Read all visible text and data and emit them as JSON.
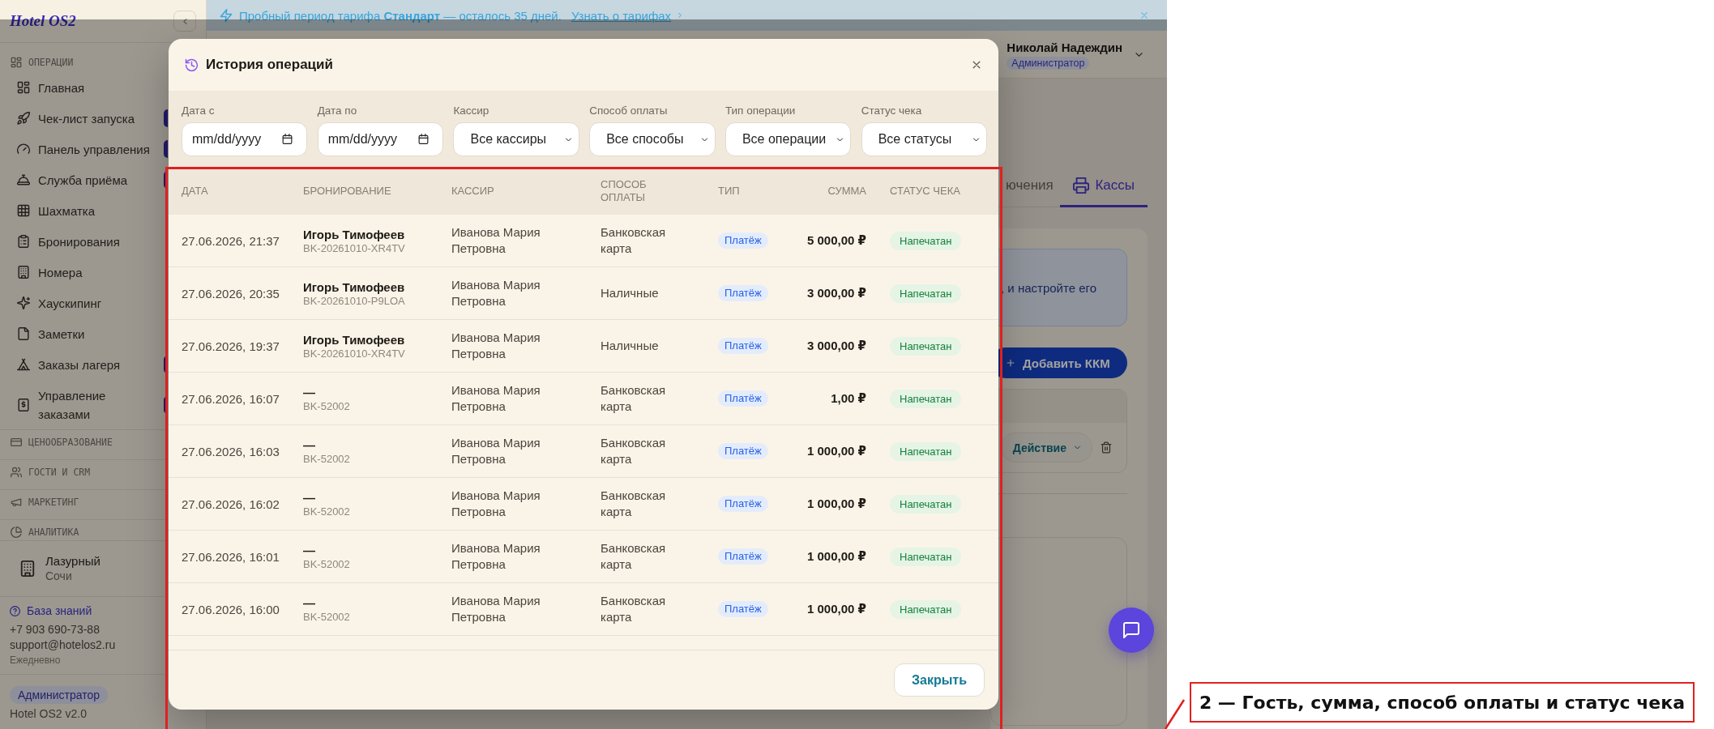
{
  "sidebar": {
    "logo": "Hotel OS2",
    "sections": [
      {
        "title": "ОПЕРАЦИИ",
        "items": [
          {
            "label": "Главная",
            "badge": false
          },
          {
            "label": "Чек-лист запуска",
            "badge": true
          },
          {
            "label": "Панель управления",
            "badge": true
          },
          {
            "label": "Служба приёма",
            "badge": true
          },
          {
            "label": "Шахматка",
            "badge": false
          },
          {
            "label": "Бронирования",
            "badge": false
          },
          {
            "label": "Номера",
            "badge": false
          },
          {
            "label": "Хаускипинг",
            "badge": false
          },
          {
            "label": "Заметки",
            "badge": false
          },
          {
            "label": "Заказы лагеря",
            "badge": true
          },
          {
            "label": "Управление заказами",
            "badge": true
          }
        ]
      },
      {
        "title": "ЦЕНООБРАЗОВАНИЕ"
      },
      {
        "title": "ГОСТИ И CRM"
      },
      {
        "title": "МАРКЕТИНГ"
      },
      {
        "title": "АНАЛИТИКА"
      }
    ],
    "property": {
      "name": "Лазурный",
      "city": "Сочи"
    },
    "support": {
      "knowledge_base": "База знаний",
      "phone": "+7 903 690-73-88",
      "email": "support@hotelos2.ru",
      "hours": "Ежедневно"
    },
    "role": "Администратор",
    "version": "Hotel OS2 v2.0"
  },
  "banner": {
    "text": "Пробный период тарифа **Стандарт** — осталось 35 дней.",
    "link": "Узнать о тарифах"
  },
  "header": {
    "user_name": "Николай Надеждин",
    "user_role": "Администратор"
  },
  "page": {
    "tabs": [
      {
        "label": "ючения",
        "selected": false
      },
      {
        "label": "Кассы",
        "selected": true
      }
    ],
    "info_text": ", и настройте его",
    "add_button": "Добавить ККМ",
    "action_button": "Действие"
  },
  "modal": {
    "title": "История операций",
    "filters": [
      {
        "kind": "date",
        "label": "Дата с",
        "placeholder": "mm/dd/yyyy"
      },
      {
        "kind": "date",
        "label": "Дата по",
        "placeholder": "mm/dd/yyyy"
      },
      {
        "kind": "select",
        "label": "Кассир",
        "value": "Все кассиры"
      },
      {
        "kind": "select",
        "label": "Способ оплаты",
        "value": "Все способы"
      },
      {
        "kind": "select",
        "label": "Тип операции",
        "value": "Все операции"
      },
      {
        "kind": "select",
        "label": "Статус чека",
        "value": "Все статусы"
      }
    ],
    "table": {
      "columns": [
        "ДАТА",
        "БРОНИРОВАНИЕ",
        "КАССИР",
        "СПОСОБ ОПЛАТЫ",
        "ТИП",
        "СУММА",
        "СТАТУС ЧЕКА"
      ],
      "rows": [
        {
          "date": "27.06.2026, 21:37",
          "guest": "Игорь Тимофеев",
          "booking": "BK-20261010-XR4TV",
          "cashier": "Иванова Мария Петровна",
          "payment_method": "Банковская карта",
          "type": "Платёж",
          "amount": "5 000,00 ₽",
          "receipt_status": "Напечатан"
        },
        {
          "date": "27.06.2026, 20:35",
          "guest": "Игорь Тимофеев",
          "booking": "BK-20261010-P9LOA",
          "cashier": "Иванова Мария Петровна",
          "payment_method": "Наличные",
          "type": "Платёж",
          "amount": "3 000,00 ₽",
          "receipt_status": "Напечатан"
        },
        {
          "date": "27.06.2026, 19:37",
          "guest": "Игорь Тимофеев",
          "booking": "BK-20261010-XR4TV",
          "cashier": "Иванова Мария Петровна",
          "payment_method": "Наличные",
          "type": "Платёж",
          "amount": "3 000,00 ₽",
          "receipt_status": "Напечатан"
        },
        {
          "date": "27.06.2026, 16:07",
          "guest": "—",
          "booking": "BK-52002",
          "cashier": "Иванова Мария Петровна",
          "payment_method": "Банковская карта",
          "type": "Платёж",
          "amount": "1,00 ₽",
          "receipt_status": "Напечатан"
        },
        {
          "date": "27.06.2026, 16:03",
          "guest": "—",
          "booking": "BK-52002",
          "cashier": "Иванова Мария Петровна",
          "payment_method": "Банковская карта",
          "type": "Платёж",
          "amount": "1 000,00 ₽",
          "receipt_status": "Напечатан"
        },
        {
          "date": "27.06.2026, 16:02",
          "guest": "—",
          "booking": "BK-52002",
          "cashier": "Иванова Мария Петровна",
          "payment_method": "Банковская карта",
          "type": "Платёж",
          "amount": "1 000,00 ₽",
          "receipt_status": "Напечатан"
        },
        {
          "date": "27.06.2026, 16:01",
          "guest": "—",
          "booking": "BK-52002",
          "cashier": "Иванова Мария Петровна",
          "payment_method": "Банковская карта",
          "type": "Платёж",
          "amount": "1 000,00 ₽",
          "receipt_status": "Напечатан"
        },
        {
          "date": "27.06.2026, 16:00",
          "guest": "—",
          "booking": "BK-52002",
          "cashier": "Иванова Мария Петровна",
          "payment_method": "Банковская карта",
          "type": "Платёж",
          "amount": "1 000,00 ₽",
          "receipt_status": "Напечатан"
        }
      ]
    },
    "close_button": "Закрыть"
  },
  "annotation": {
    "label": "2 — Гость, сумма, способ оплаты и статус чека"
  }
}
